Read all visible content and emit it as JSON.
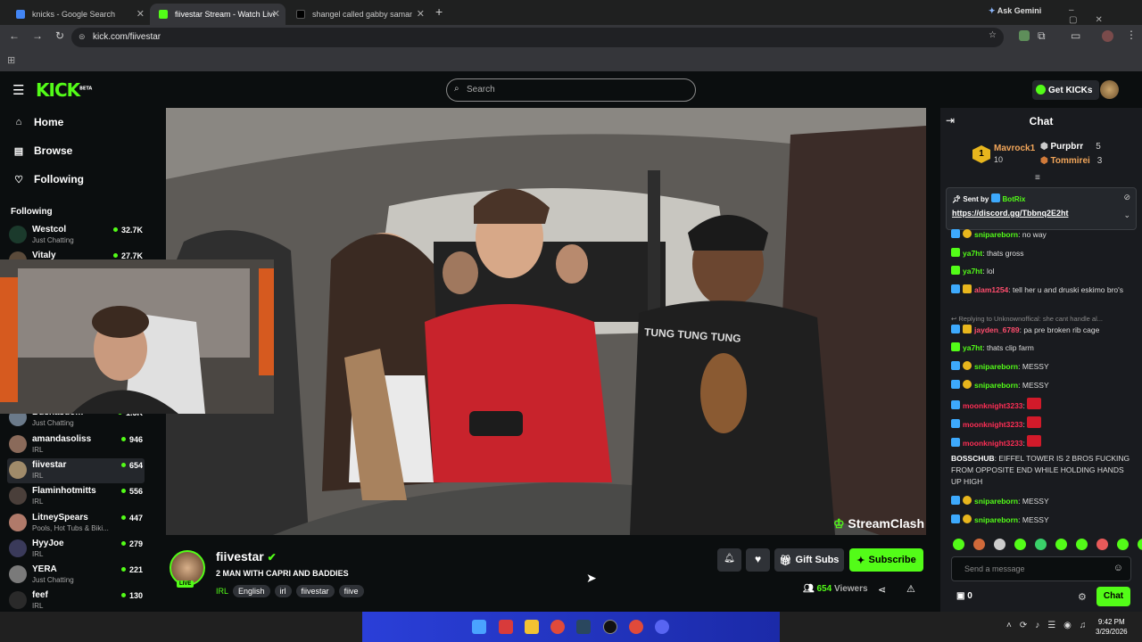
{
  "browser": {
    "tabs": [
      {
        "title": "knicks - Google Search"
      },
      {
        "title": "fiivestar Stream - Watch Live o"
      },
      {
        "title": "shangel called gabby samanth"
      }
    ],
    "url": "kick.com/fiivestar",
    "ask_gemini": "Ask Gemini"
  },
  "header": {
    "logo": "KICK",
    "beta": "BETA",
    "search_placeholder": "Search",
    "get_kicks": "Get KICKs"
  },
  "sidebar": {
    "nav": [
      {
        "label": "Home",
        "icon": "home-icon"
      },
      {
        "label": "Browse",
        "icon": "browse-icon"
      },
      {
        "label": "Following",
        "icon": "heart-icon"
      }
    ],
    "section_title": "Following",
    "channels": [
      {
        "name": "Westcol",
        "category": "Just Chatting",
        "viewers": "32.7K"
      },
      {
        "name": "Vitaly",
        "category": "",
        "viewers": "27.7K"
      },
      {
        "name": "Bushasdom",
        "category": "Just Chatting",
        "viewers": "1.5K"
      },
      {
        "name": "amandasoliss",
        "category": "IRL",
        "viewers": "946"
      },
      {
        "name": "fiivestar",
        "category": "IRL",
        "viewers": "654"
      },
      {
        "name": "Flaminhotmitts",
        "category": "IRL",
        "viewers": "556"
      },
      {
        "name": "LitneySpears",
        "category": "Pools, Hot Tubs & Biki...",
        "viewers": "447"
      },
      {
        "name": "HyyJoe",
        "category": "IRL",
        "viewers": "279"
      },
      {
        "name": "YERA",
        "category": "Just Chatting",
        "viewers": "221"
      },
      {
        "name": "feef",
        "category": "IRL",
        "viewers": "130"
      }
    ]
  },
  "video": {
    "watermark": "StreamClash",
    "shirt_text": "TUNG TUNG TUNG"
  },
  "stream": {
    "streamer": "fiivestar",
    "live_badge": "LIVE",
    "title": "2 MAN WITH CAPRI AND BADDIES",
    "category": "IRL",
    "tags": [
      "English",
      "irl",
      "fiivestar",
      "fiive"
    ],
    "gift_subs": "Gift Subs",
    "subscribe": "Subscribe",
    "viewers": "654",
    "viewers_label": "Viewers"
  },
  "chat": {
    "title": "Chat",
    "leaderboard": [
      {
        "rank": "1",
        "name": "Mavrock1",
        "count": "10"
      },
      {
        "name": "Purpbrr",
        "count": "5"
      },
      {
        "name": "Tommirei",
        "count": "3"
      }
    ],
    "pinned": {
      "label": "Sent by",
      "author": "BotRix",
      "link": "https://discord.gg/Tbbnq2E2ht"
    },
    "messages": [
      {
        "user": "snipareborn",
        "text": "no way",
        "color": "#53fc18"
      },
      {
        "user": "ya7ht",
        "text": "thats gross",
        "color": "#53fc18"
      },
      {
        "user": "ya7ht",
        "text": "lol",
        "color": "#53fc18"
      },
      {
        "user": "alam1254",
        "text": "tell her u and druski eskimo bro's",
        "color": "#ff4d6d"
      },
      {
        "user": "",
        "text": "Replying to Unknownoffical: she cant handle al...",
        "color": "#888"
      },
      {
        "user": "jayden_6789",
        "text": "pa pre broken rib cage",
        "color": "#ff4d6d"
      },
      {
        "user": "ya7ht",
        "text": "thats clip farm",
        "color": "#53fc18"
      },
      {
        "user": "snipareborn",
        "text": "MESSY",
        "color": "#53fc18"
      },
      {
        "user": "snipareborn",
        "text": "MESSY",
        "color": "#53fc18"
      },
      {
        "user": "moonknight3233",
        "text": "",
        "color": "#ff2e55"
      },
      {
        "user": "moonknight3233",
        "text": "",
        "color": "#ff2e55"
      },
      {
        "user": "moonknight3233",
        "text": "",
        "color": "#ff2e55"
      },
      {
        "user": "BOSSCHUB",
        "text": "EIFFEL TOWER IS 2 BROS FUCKING FROM OPPOSITE END WHILE HOLDING HANDS UP HIGH",
        "color": "#ffffff"
      },
      {
        "user": "snipareborn",
        "text": "MESSY",
        "color": "#53fc18"
      },
      {
        "user": "snipareborn",
        "text": "MESSY",
        "color": "#53fc18"
      }
    ],
    "input_placeholder": "Send a message",
    "points": "0",
    "send_button": "Chat"
  },
  "taskbar": {
    "time": "9:42 PM",
    "date": "3/29/2026"
  },
  "colors": {
    "accent": "#53fc18",
    "bg": "#0b0e0f",
    "chat_bg": "#191b1f"
  }
}
